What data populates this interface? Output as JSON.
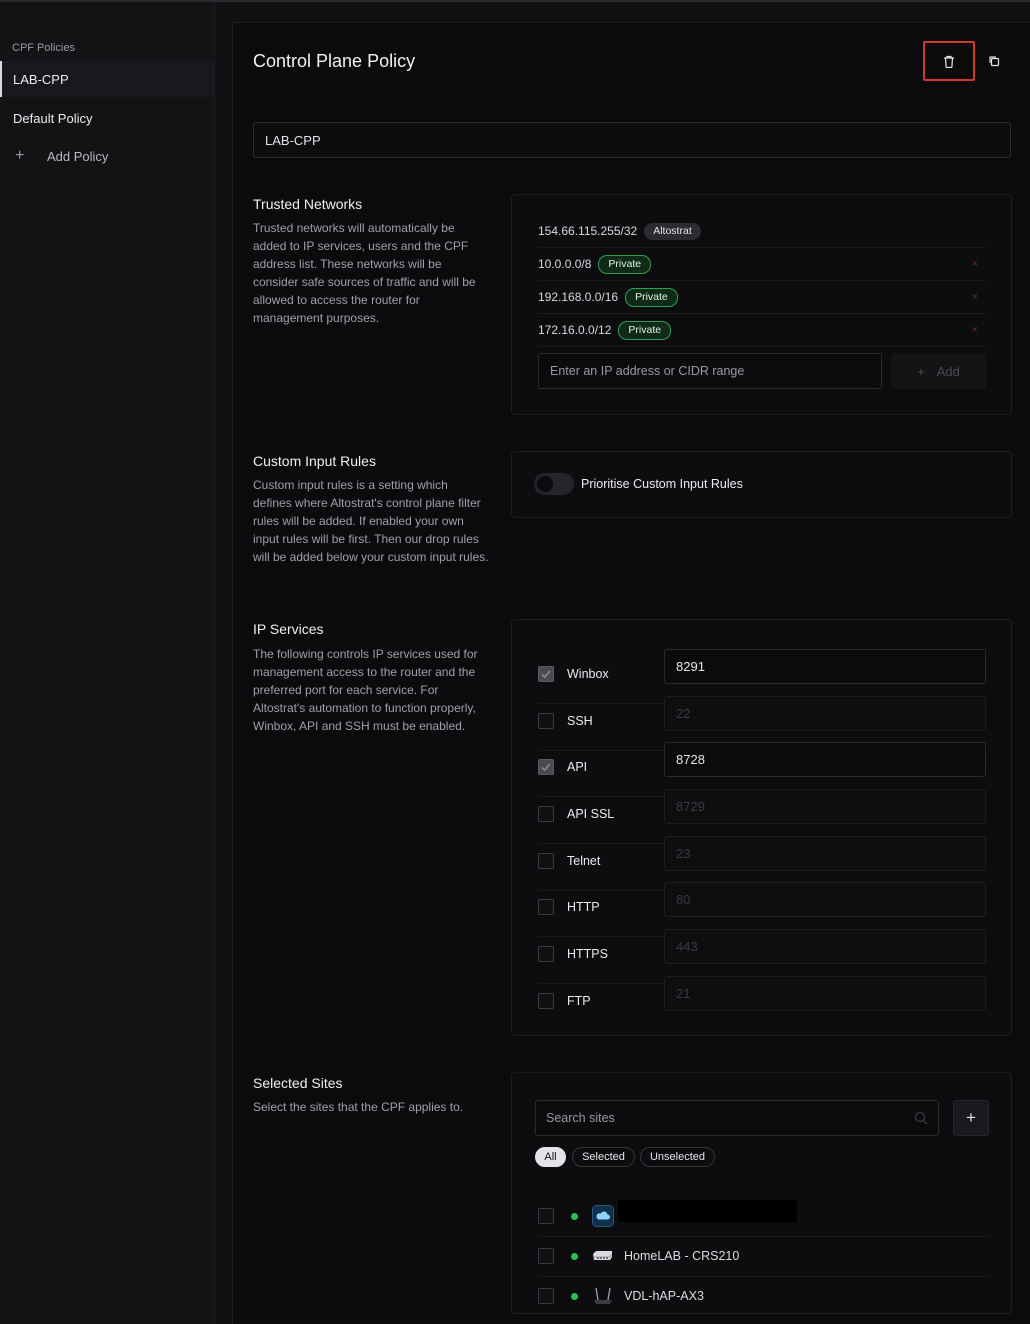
{
  "sidebar": {
    "heading": "CPF Policies",
    "items": [
      {
        "label": "LAB-CPP",
        "active": true
      },
      {
        "label": "Default Policy",
        "active": false
      }
    ],
    "add_label": "Add Policy"
  },
  "header": {
    "title": "Control Plane Policy",
    "delete_icon": "trash-icon",
    "copy_icon": "copy-icon"
  },
  "policy_name": "LAB-CPP",
  "trusted_networks": {
    "title": "Trusted Networks",
    "description": "Trusted networks will automatically be added to IP services, users and the CPF address list. These networks will be consider safe sources of traffic and will be allowed to access the router for management purposes.",
    "entries": [
      {
        "cidr": "154.66.115.255/32",
        "badge": "Altostrat",
        "badge_color": "#2b2b30",
        "removable": false
      },
      {
        "cidr": "10.0.0.0/8",
        "badge": "Private",
        "badge_color": "#0f2a17",
        "removable": true
      },
      {
        "cidr": "192.168.0.0/16",
        "badge": "Private",
        "badge_color": "#0f2a17",
        "removable": true
      },
      {
        "cidr": "172.16.0.0/12",
        "badge": "Private",
        "badge_color": "#0f2a17",
        "removable": true
      }
    ],
    "remove_glyph": "×",
    "input_placeholder": "Enter an IP address or CIDR range",
    "add_label": "Add"
  },
  "custom_input_rules": {
    "title": "Custom Input Rules",
    "description": "Custom input rules is a setting which defines where Altostrat's control plane filter rules will be added. If enabled your own input rules will be first. Then our drop rules will be added below your custom input rules.",
    "toggle_label": "Prioritise Custom Input Rules",
    "toggle_on": false
  },
  "ip_services": {
    "title": "IP Services",
    "description": "The following controls IP services used for management access to the router and the preferred port for each service. For Altostrat's automation to function properly, Winbox, API and SSH must be enabled.",
    "services": [
      {
        "name": "Winbox",
        "enabled": true,
        "port": "8291"
      },
      {
        "name": "SSH",
        "enabled": false,
        "port": "22"
      },
      {
        "name": "API",
        "enabled": true,
        "port": "8728"
      },
      {
        "name": "API SSL",
        "enabled": false,
        "port": "8729"
      },
      {
        "name": "Telnet",
        "enabled": false,
        "port": "23"
      },
      {
        "name": "HTTP",
        "enabled": false,
        "port": "80"
      },
      {
        "name": "HTTPS",
        "enabled": false,
        "port": "443"
      },
      {
        "name": "FTP",
        "enabled": false,
        "port": "21"
      }
    ]
  },
  "selected_sites": {
    "title": "Selected Sites",
    "description": "Select the sites that the CPF applies to.",
    "search_placeholder": "Search sites",
    "add_glyph": "+",
    "filters": [
      {
        "label": "All",
        "active": true
      },
      {
        "label": "Selected",
        "active": false
      },
      {
        "label": "Unselected",
        "active": false
      }
    ],
    "sites": [
      {
        "name": "",
        "redacted": true,
        "icon": "cloud-icon",
        "status_color": "#2dbe5a"
      },
      {
        "name": "HomeLAB - CRS210",
        "redacted": false,
        "icon": "switch-icon",
        "status_color": "#2dbe5a"
      },
      {
        "name": "VDL-hAP-AX3",
        "redacted": false,
        "icon": "router-icon",
        "status_color": "#2dbe5a"
      }
    ]
  }
}
